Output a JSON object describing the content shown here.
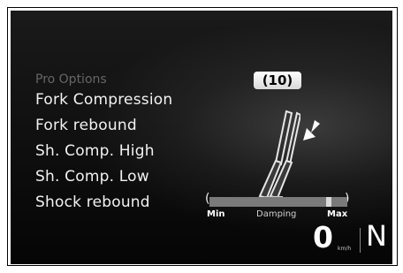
{
  "menu": {
    "header": "Pro Options",
    "items": [
      {
        "label": "Fork Compression"
      },
      {
        "label": "Fork rebound"
      },
      {
        "label": "Sh. Comp. High"
      },
      {
        "label": "Sh. Comp. Low"
      },
      {
        "label": "Shock rebound"
      }
    ]
  },
  "setting": {
    "value_display": "(10)"
  },
  "damping_bar": {
    "left_chevron": "(",
    "right_chevron": ")",
    "min_label": "Min",
    "center_label": "Damping",
    "max_label": "Max",
    "level_fraction": 0.88
  },
  "status": {
    "speed_value": "0",
    "speed_unit": "km/h",
    "gear": "N"
  },
  "icons": {
    "fork": "fork-suspension-icon",
    "compress_arrow": "arrow-down-left-icon"
  }
}
